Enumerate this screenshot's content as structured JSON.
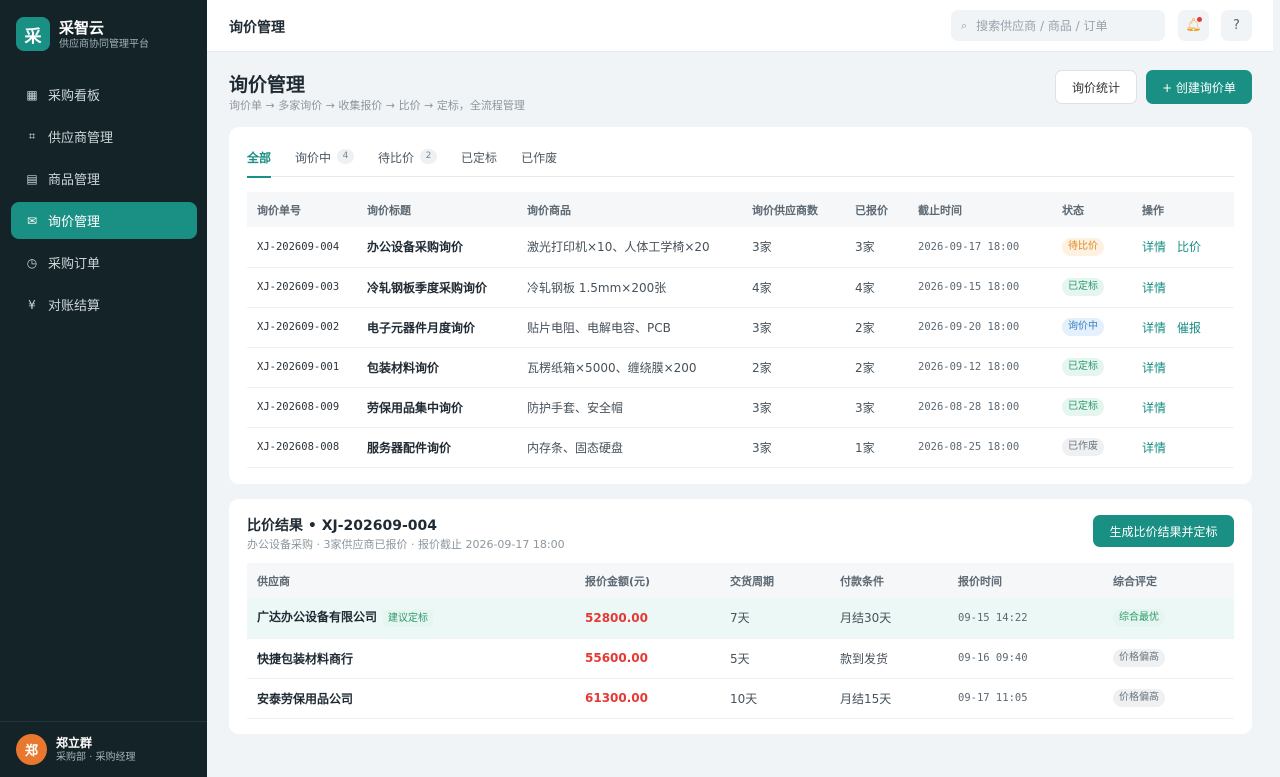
{
  "app": {
    "logo_char": "采",
    "name": "采智云",
    "subtitle": "供应商协同管理平台"
  },
  "nav": [
    {
      "icon": "grid-icon",
      "glyph": "▦",
      "label": "采购看板",
      "active": false
    },
    {
      "icon": "hash-icon",
      "glyph": "⌗",
      "label": "供应商管理",
      "active": false
    },
    {
      "icon": "list-icon",
      "glyph": "▤",
      "label": "商品管理",
      "active": false
    },
    {
      "icon": "mail-icon",
      "glyph": "✉",
      "label": "询价管理",
      "active": true
    },
    {
      "icon": "clock-icon",
      "glyph": "◷",
      "label": "采购订单",
      "active": false
    },
    {
      "icon": "yen-icon",
      "glyph": "¥",
      "label": "对账结算",
      "active": false
    }
  ],
  "user": {
    "avatar_char": "郑",
    "name": "郑立群",
    "role": "采购部 · 采购经理"
  },
  "topbar": {
    "title": "询价管理",
    "search_placeholder": "搜索供应商 / 商品 / 订单",
    "bell_icon": "bell-icon",
    "help_label": "?"
  },
  "page": {
    "title": "询价管理",
    "subtitle": "询价单 → 多家询价 → 收集报价 → 比价 → 定标，全流程管理",
    "stats_button": "询价统计",
    "create_button": "+ 创建询价单"
  },
  "tabs": [
    {
      "label": "全部",
      "count": "",
      "active": true
    },
    {
      "label": "询价中",
      "count": "4",
      "active": false
    },
    {
      "label": "待比价",
      "count": "2",
      "active": false
    },
    {
      "label": "已定标",
      "count": "",
      "active": false
    },
    {
      "label": "已作废",
      "count": "",
      "active": false
    }
  ],
  "inquiry_table": {
    "headers": [
      "询价单号",
      "询价标题",
      "询价商品",
      "询价供应商数",
      "已报价",
      "截止时间",
      "状态",
      "操作"
    ],
    "rows": [
      {
        "code": "XJ-202609-004",
        "title": "办公设备采购询价",
        "items": "激光打印机×10、人体工学椅×20",
        "suppliers": "3家",
        "quoted": "3家",
        "deadline": "2026-09-17 18:00",
        "status": "待比价",
        "status_color": "#e08a20",
        "actions": [
          "详情",
          "比价"
        ]
      },
      {
        "code": "XJ-202609-003",
        "title": "冷轧钢板季度采购询价",
        "items": "冷轧钢板 1.5mm×200张",
        "suppliers": "4家",
        "quoted": "4家",
        "deadline": "2026-09-15 18:00",
        "status": "已定标",
        "status_color": "#2f9a6e",
        "actions": [
          "详情"
        ]
      },
      {
        "code": "XJ-202609-002",
        "title": "电子元器件月度询价",
        "items": "贴片电阻、电解电容、PCB",
        "suppliers": "3家",
        "quoted": "2家",
        "deadline": "2026-09-20 18:00",
        "status": "询价中",
        "status_color": "#3b82c4",
        "actions": [
          "详情",
          "催报"
        ]
      },
      {
        "code": "XJ-202609-001",
        "title": "包装材料询价",
        "items": "瓦楞纸箱×5000、缠绕膜×200",
        "suppliers": "2家",
        "quoted": "2家",
        "deadline": "2026-09-12 18:00",
        "status": "已定标",
        "status_color": "#2f9a6e",
        "actions": [
          "详情"
        ]
      },
      {
        "code": "XJ-202608-009",
        "title": "劳保用品集中询价",
        "items": "防护手套、安全帽",
        "suppliers": "3家",
        "quoted": "3家",
        "deadline": "2026-08-28 18:00",
        "status": "已定标",
        "status_color": "#2f9a6e",
        "actions": [
          "详情"
        ]
      },
      {
        "code": "XJ-202608-008",
        "title": "服务器配件询价",
        "items": "内存条、固态硬盘",
        "suppliers": "3家",
        "quoted": "1家",
        "deadline": "2026-08-25 18:00",
        "status": "已作废",
        "status_color": "#6b7680",
        "actions": [
          "详情"
        ]
      }
    ]
  },
  "comparison": {
    "title": "比价结果 • XJ-202609-004",
    "subtitle": "办公设备采购 · 3家供应商已报价 · 报价截止 2026-09-17 18:00",
    "generate_button": "生成比价结果并定标",
    "headers": [
      "供应商",
      "报价金额(元)",
      "交货周期",
      "付款条件",
      "报价时间",
      "综合评定"
    ],
    "rows": [
      {
        "supplier": "广达办公设备有限公司",
        "tag": "建议定标",
        "price": "52800.00",
        "delivery": "7天",
        "payment": "月结30天",
        "time": "09-15 14:22",
        "rating": "综合最优",
        "rating_style": "green",
        "best": true
      },
      {
        "supplier": "快捷包装材料商行",
        "tag": "",
        "price": "55600.00",
        "delivery": "5天",
        "payment": "款到发货",
        "time": "09-16 09:40",
        "rating": "价格偏高",
        "rating_style": "gray",
        "best": false
      },
      {
        "supplier": "安泰劳保用品公司",
        "tag": "",
        "price": "61300.00",
        "delivery": "10天",
        "payment": "月结15天",
        "time": "09-17 11:05",
        "rating": "价格偏高",
        "rating_style": "gray",
        "best": false
      }
    ]
  }
}
